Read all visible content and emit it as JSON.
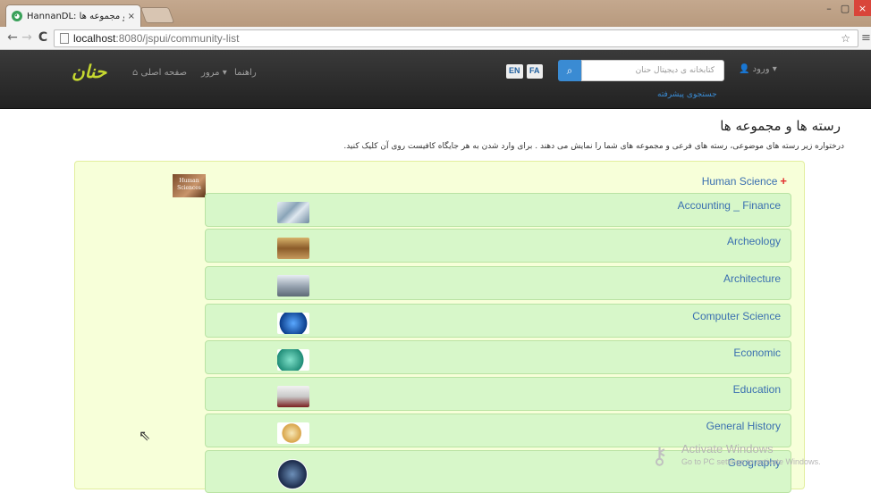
{
  "browser": {
    "tab_title": "HannanDL: رسته ها و مجموعه ها",
    "tab_close": "×",
    "url_host": "localhost",
    "url_path": ":8080/jspui/community-list",
    "win_min": "–",
    "win_max": "▢",
    "win_close": "×"
  },
  "navbar": {
    "logo": "حنان",
    "home": "صفحه اصلی",
    "browse": "مرور ▾",
    "help": "راهنما",
    "lang_en": "EN",
    "lang_fa": "FA",
    "search_placeholder": "کتابخانه ی دیجیتال حنان",
    "advanced_search": "جستجوی پیشرفته",
    "login": "ورود ▾"
  },
  "page": {
    "title": "رسته ها و مجموعه ها",
    "description": "درختواره زیر رسته های موضوعی، رسته های فرعی و مجموعه های شما را نمایش می دهند . برای وارد شدن به هر جایگاه کافیست روی آن کلیک کنید."
  },
  "community": {
    "name": "Human Science",
    "logo_text": "Human Sciences",
    "expand_symbol": "+",
    "subcommunities": [
      {
        "name": "Accounting _ Finance",
        "thumb": "finance-image"
      },
      {
        "name": "Archeology",
        "thumb": "archeology-image"
      },
      {
        "name": "Architecture",
        "thumb": "architecture-image"
      },
      {
        "name": "Computer Science",
        "thumb": "globe-image"
      },
      {
        "name": "Economic",
        "thumb": "economic-image"
      },
      {
        "name": "Education",
        "thumb": "education-image"
      },
      {
        "name": "General History",
        "thumb": "history-image"
      },
      {
        "name": "Geography",
        "thumb": "geography-image"
      }
    ]
  },
  "watermark": {
    "title": "Activate Windows",
    "subtitle": "Go to PC settings to activate Windows."
  },
  "colors": {
    "community_bg": "#f7ffd9",
    "subcommunity_bg": "#d7f7c9",
    "link": "#3a6fb0",
    "navbar": "#2b2b2b"
  }
}
